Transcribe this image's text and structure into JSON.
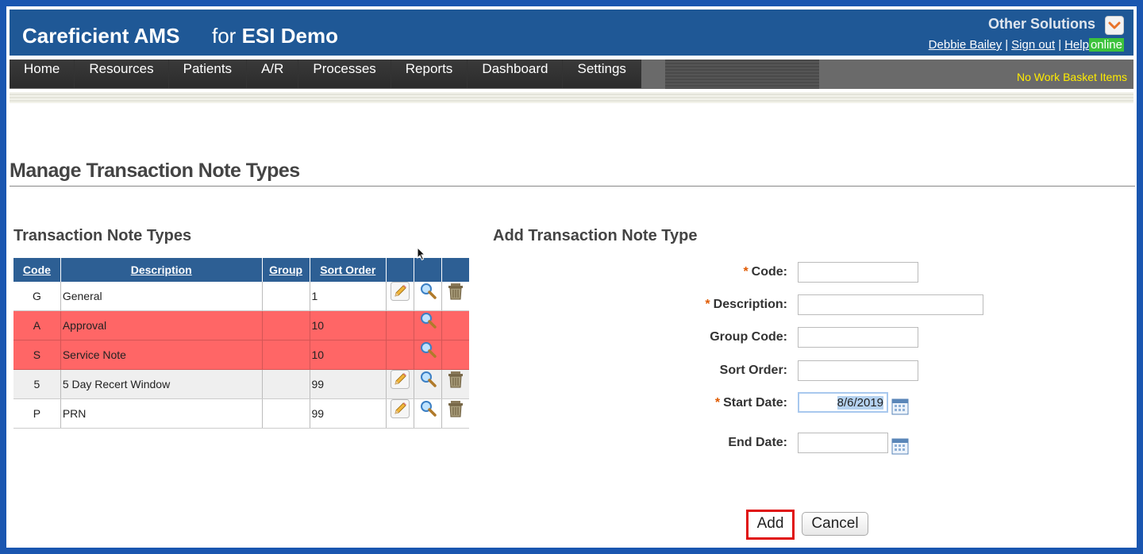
{
  "header": {
    "app_name": "Careficient AMS",
    "for_prefix": "for",
    "org_name": "ESI Demo",
    "other_solutions": "Other Solutions",
    "user_name": "Debbie Bailey",
    "sign_out": "Sign out",
    "help": "Help",
    "status": "online",
    "separator": "|"
  },
  "nav": {
    "items": [
      "Home",
      "Resources",
      "Patients",
      "A/R",
      "Processes",
      "Reports",
      "Dashboard",
      "Settings"
    ],
    "work_basket": "No Work Basket Items"
  },
  "page": {
    "title": "Manage Transaction Note Types"
  },
  "list": {
    "title": "Transaction Note Types",
    "columns": [
      "Code",
      "Description",
      "Group",
      "Sort Order"
    ],
    "rows": [
      {
        "code": "G",
        "description": "General",
        "group": "",
        "sort_order": "1",
        "status": "normal",
        "editable": true,
        "deletable": true
      },
      {
        "code": "A",
        "description": "Approval",
        "group": "",
        "sort_order": "10",
        "status": "inactive",
        "editable": false,
        "deletable": false
      },
      {
        "code": "S",
        "description": "Service Note",
        "group": "",
        "sort_order": "10",
        "status": "inactive",
        "editable": false,
        "deletable": false
      },
      {
        "code": "5",
        "description": "5 Day Recert Window",
        "group": "",
        "sort_order": "99",
        "status": "alt",
        "editable": true,
        "deletable": true
      },
      {
        "code": "P",
        "description": "PRN",
        "group": "",
        "sort_order": "99",
        "status": "normal",
        "editable": true,
        "deletable": true
      }
    ]
  },
  "form": {
    "title": "Add Transaction Note Type",
    "required_marker": "*",
    "code_label": "Code:",
    "description_label": "Description:",
    "group_code_label": "Group Code:",
    "sort_order_label": "Sort Order:",
    "start_date_label": "Start Date:",
    "start_date_value": "8/6/2019",
    "end_date_label": "End Date:",
    "add_button": "Add",
    "cancel_button": "Cancel"
  },
  "colors": {
    "header_bg": "#1f5896",
    "inactive_row": "#ff6666",
    "online_badge": "#3cc23c",
    "work_basket_text": "#ffec00",
    "highlight_border": "#e01010"
  }
}
